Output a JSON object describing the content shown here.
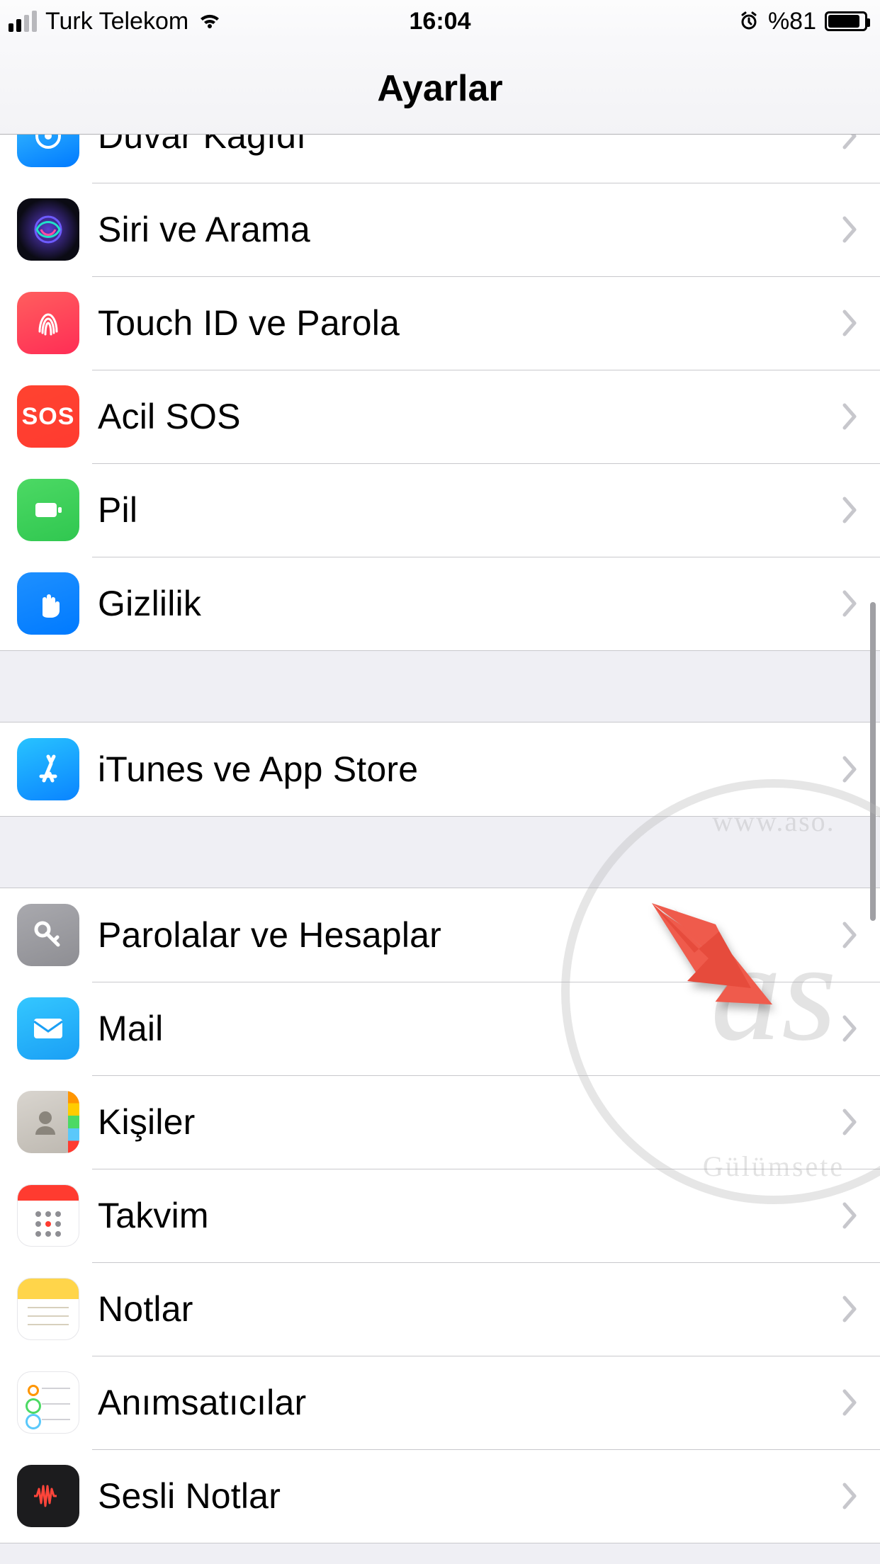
{
  "status": {
    "carrier": "Turk Telekom",
    "time": "16:04",
    "battery_text": "%81"
  },
  "nav": {
    "title": "Ayarlar"
  },
  "groups": [
    {
      "rows": [
        {
          "id": "wallpaper",
          "label": "Duvar Kağıdı",
          "icon": "wallpaper-icon"
        },
        {
          "id": "siri",
          "label": "Siri ve Arama",
          "icon": "siri-icon"
        },
        {
          "id": "touchid",
          "label": "Touch ID ve Parola",
          "icon": "fingerprint-icon"
        },
        {
          "id": "sos",
          "label": "Acil SOS",
          "icon": "sos-icon"
        },
        {
          "id": "battery",
          "label": "Pil",
          "icon": "battery-icon"
        },
        {
          "id": "privacy",
          "label": "Gizlilik",
          "icon": "hand-icon"
        }
      ]
    },
    {
      "rows": [
        {
          "id": "appstore",
          "label": "iTunes ve App Store",
          "icon": "appstore-icon"
        }
      ]
    },
    {
      "rows": [
        {
          "id": "passwords",
          "label": "Parolalar ve Hesaplar",
          "icon": "key-icon"
        },
        {
          "id": "mail",
          "label": "Mail",
          "icon": "mail-icon"
        },
        {
          "id": "contacts",
          "label": "Kişiler",
          "icon": "contacts-icon"
        },
        {
          "id": "calendar",
          "label": "Takvim",
          "icon": "calendar-icon"
        },
        {
          "id": "notes",
          "label": "Notlar",
          "icon": "notes-icon"
        },
        {
          "id": "reminders",
          "label": "Anımsatıcılar",
          "icon": "reminders-icon"
        },
        {
          "id": "voice",
          "label": "Sesli Notlar",
          "icon": "voice-memo-icon"
        }
      ]
    }
  ],
  "watermark": {
    "main": "as",
    "top": "www.aso.",
    "bottom": "Gülümsete"
  },
  "sos_text": "SOS"
}
